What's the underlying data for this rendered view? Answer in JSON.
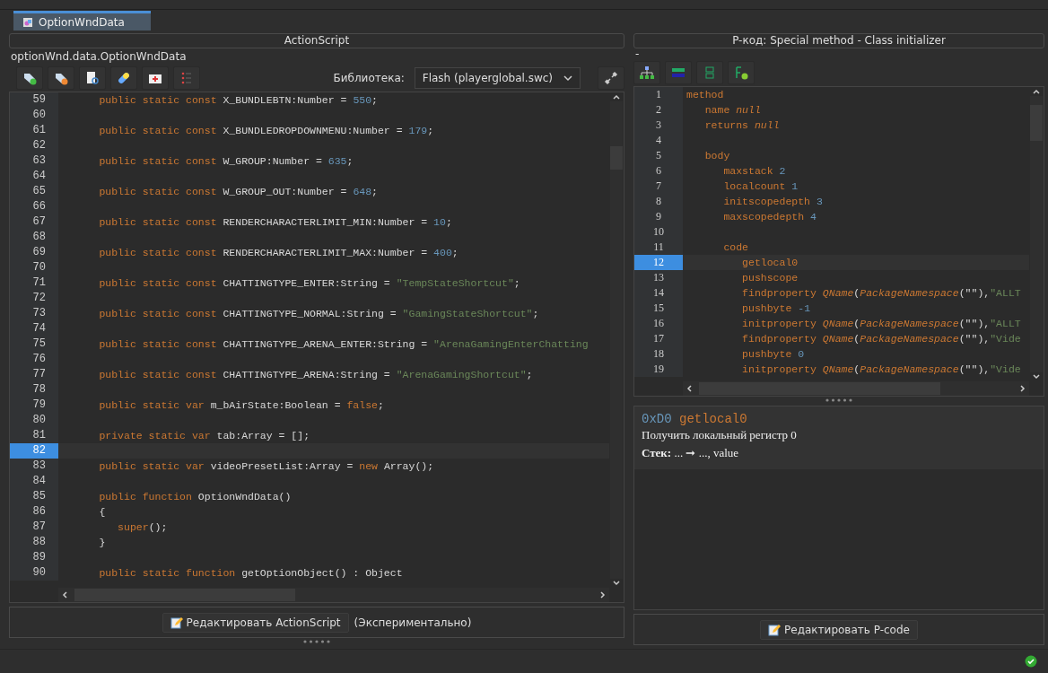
{
  "tabs": [
    {
      "label": "OptionWndData",
      "selected": true
    }
  ],
  "left_panel": {
    "title": "ActionScript",
    "path": "optionWnd.data.OptionWndData",
    "toolbar": [
      {
        "kind": "tag-plus"
      },
      {
        "kind": "tag-minus"
      },
      {
        "kind": "search-doc"
      },
      {
        "kind": "pill"
      },
      {
        "kind": "medkit"
      },
      {
        "kind": "list"
      }
    ],
    "library_label": "Библиотека:",
    "library_value": "Flash (playerglobal.swc)",
    "code_lines": [
      {
        "num": "59",
        "selected": false,
        "tokens": [
          {
            "kind": "kw",
            "text": "      public static const "
          },
          {
            "kind": "id",
            "text": "X_BUNDLEBTN:Number = "
          },
          {
            "kind": "num",
            "text": "550"
          },
          {
            "kind": "id",
            "text": ";"
          }
        ]
      },
      {
        "num": "60",
        "selected": false
      },
      {
        "num": "61",
        "selected": false,
        "tokens": [
          {
            "kind": "kw",
            "text": "      public static const "
          },
          {
            "kind": "id",
            "text": "X_BUNDLEDROPDOWNMENU:Number = "
          },
          {
            "kind": "num",
            "text": "179"
          },
          {
            "kind": "id",
            "text": ";"
          }
        ]
      },
      {
        "num": "62",
        "selected": false
      },
      {
        "num": "63",
        "selected": false,
        "tokens": [
          {
            "kind": "kw",
            "text": "      public static const "
          },
          {
            "kind": "id",
            "text": "W_GROUP:Number = "
          },
          {
            "kind": "num",
            "text": "635"
          },
          {
            "kind": "id",
            "text": ";"
          }
        ]
      },
      {
        "num": "64",
        "selected": false
      },
      {
        "num": "65",
        "selected": false,
        "tokens": [
          {
            "kind": "kw",
            "text": "      public static const "
          },
          {
            "kind": "id",
            "text": "W_GROUP_OUT:Number = "
          },
          {
            "kind": "num",
            "text": "648"
          },
          {
            "kind": "id",
            "text": ";"
          }
        ]
      },
      {
        "num": "66",
        "selected": false
      },
      {
        "num": "67",
        "selected": false,
        "tokens": [
          {
            "kind": "kw",
            "text": "      public static const "
          },
          {
            "kind": "id",
            "text": "RENDERCHARACTERLIMIT_MIN:Number = "
          },
          {
            "kind": "num",
            "text": "10"
          },
          {
            "kind": "id",
            "text": ";"
          }
        ]
      },
      {
        "num": "68",
        "selected": false
      },
      {
        "num": "69",
        "selected": false,
        "tokens": [
          {
            "kind": "kw",
            "text": "      public static const "
          },
          {
            "kind": "id",
            "text": "RENDERCHARACTERLIMIT_MAX:Number = "
          },
          {
            "kind": "num",
            "text": "400"
          },
          {
            "kind": "id",
            "text": ";"
          }
        ]
      },
      {
        "num": "70",
        "selected": false
      },
      {
        "num": "71",
        "selected": false,
        "tokens": [
          {
            "kind": "kw",
            "text": "      public static const "
          },
          {
            "kind": "id",
            "text": "CHATTINGTYPE_ENTER:String = "
          },
          {
            "kind": "str",
            "text": "\"TempStateShortcut\""
          },
          {
            "kind": "id",
            "text": ";"
          }
        ]
      },
      {
        "num": "72",
        "selected": false
      },
      {
        "num": "73",
        "selected": false,
        "tokens": [
          {
            "kind": "kw",
            "text": "      public static const "
          },
          {
            "kind": "id",
            "text": "CHATTINGTYPE_NORMAL:String = "
          },
          {
            "kind": "str",
            "text": "\"GamingStateShortcut\""
          },
          {
            "kind": "id",
            "text": ";"
          }
        ]
      },
      {
        "num": "74",
        "selected": false
      },
      {
        "num": "75",
        "selected": false,
        "tokens": [
          {
            "kind": "kw",
            "text": "      public static const "
          },
          {
            "kind": "id",
            "text": "CHATTINGTYPE_ARENA_ENTER:String = "
          },
          {
            "kind": "str",
            "text": "\"ArenaGamingEnterChatting"
          }
        ]
      },
      {
        "num": "76",
        "selected": false
      },
      {
        "num": "77",
        "selected": false,
        "tokens": [
          {
            "kind": "kw",
            "text": "      public static const "
          },
          {
            "kind": "id",
            "text": "CHATTINGTYPE_ARENA:String = "
          },
          {
            "kind": "str",
            "text": "\"ArenaGamingShortcut\""
          },
          {
            "kind": "id",
            "text": ";"
          }
        ]
      },
      {
        "num": "78",
        "selected": false
      },
      {
        "num": "79",
        "selected": false,
        "tokens": [
          {
            "kind": "kw",
            "text": "      public static var "
          },
          {
            "kind": "id",
            "text": "m_bAirState:Boolean = "
          },
          {
            "kind": "kw",
            "text": "false"
          },
          {
            "kind": "id",
            "text": ";"
          }
        ]
      },
      {
        "num": "80",
        "selected": false
      },
      {
        "num": "81",
        "selected": false,
        "tokens": [
          {
            "kind": "kw",
            "text": "      private static var "
          },
          {
            "kind": "id",
            "text": "tab:Array = [];"
          }
        ]
      },
      {
        "num": "82",
        "selected": true
      },
      {
        "num": "83",
        "selected": false,
        "tokens": [
          {
            "kind": "kw",
            "text": "      public static var "
          },
          {
            "kind": "id",
            "text": "videoPresetList:Array = "
          },
          {
            "kind": "kw",
            "text": "new "
          },
          {
            "kind": "id",
            "text": "Array();"
          }
        ]
      },
      {
        "num": "84",
        "selected": false
      },
      {
        "num": "85",
        "selected": false,
        "tokens": [
          {
            "kind": "kw",
            "text": "      public function "
          },
          {
            "kind": "id",
            "text": "OptionWndData()"
          }
        ]
      },
      {
        "num": "86",
        "selected": false,
        "tokens": [
          {
            "kind": "id",
            "text": "      {"
          }
        ]
      },
      {
        "num": "87",
        "selected": false,
        "tokens": [
          {
            "kind": "kw",
            "text": "         super"
          },
          {
            "kind": "id",
            "text": "();"
          }
        ]
      },
      {
        "num": "88",
        "selected": false,
        "tokens": [
          {
            "kind": "id",
            "text": "      }"
          }
        ]
      },
      {
        "num": "89",
        "selected": false
      },
      {
        "num": "90",
        "selected": false,
        "tokens": [
          {
            "kind": "kw",
            "text": "      public static function "
          },
          {
            "kind": "id",
            "text": "getOptionObject() : Object"
          }
        ]
      }
    ],
    "edit_button": "Редактировать ActionScript",
    "edit_note": "(Экспериментально)"
  },
  "right_panel": {
    "title": "P-код: Special method - Class initializer",
    "subtitle": "-",
    "toolbar": [
      {
        "kind": "tree"
      },
      {
        "kind": "hex-text"
      },
      {
        "kind": "hex"
      },
      {
        "kind": "add-func"
      }
    ],
    "code_lines": [
      {
        "num": "1",
        "selected": false,
        "tokens": [
          {
            "kind": "kw",
            "text": "method"
          }
        ]
      },
      {
        "num": "2",
        "selected": false,
        "tokens": [
          {
            "kind": "kw",
            "text": "   name "
          },
          {
            "kind": "it",
            "text": "null"
          }
        ]
      },
      {
        "num": "3",
        "selected": false,
        "tokens": [
          {
            "kind": "kw",
            "text": "   returns "
          },
          {
            "kind": "it",
            "text": "null"
          }
        ]
      },
      {
        "num": "4",
        "selected": false
      },
      {
        "num": "5",
        "selected": false,
        "tokens": [
          {
            "kind": "kw",
            "text": "   body"
          }
        ]
      },
      {
        "num": "6",
        "selected": false,
        "tokens": [
          {
            "kind": "kw",
            "text": "      maxstack "
          },
          {
            "kind": "num",
            "text": "2"
          }
        ]
      },
      {
        "num": "7",
        "selected": false,
        "tokens": [
          {
            "kind": "kw",
            "text": "      localcount "
          },
          {
            "kind": "num",
            "text": "1"
          }
        ]
      },
      {
        "num": "8",
        "selected": false,
        "tokens": [
          {
            "kind": "kw",
            "text": "      initscopedepth "
          },
          {
            "kind": "num",
            "text": "3"
          }
        ]
      },
      {
        "num": "9",
        "selected": false,
        "tokens": [
          {
            "kind": "kw",
            "text": "      maxscopedepth "
          },
          {
            "kind": "num",
            "text": "4"
          }
        ]
      },
      {
        "num": "10",
        "selected": false
      },
      {
        "num": "11",
        "selected": false,
        "tokens": [
          {
            "kind": "kw",
            "text": "      code"
          }
        ]
      },
      {
        "num": "12",
        "selected": true,
        "tokens": [
          {
            "kind": "kw",
            "text": "         getlocal0"
          }
        ]
      },
      {
        "num": "13",
        "selected": false,
        "tokens": [
          {
            "kind": "kw",
            "text": "         pushscope"
          }
        ]
      },
      {
        "num": "14",
        "selected": false,
        "tokens": [
          {
            "kind": "kw",
            "text": "         findproperty "
          },
          {
            "kind": "it",
            "text": "QName"
          },
          {
            "kind": "id",
            "text": "("
          },
          {
            "kind": "it",
            "text": "PackageNamespace"
          },
          {
            "kind": "id",
            "text": "(\"\"),"
          },
          {
            "kind": "str",
            "text": "\"ALLT"
          }
        ]
      },
      {
        "num": "15",
        "selected": false,
        "tokens": [
          {
            "kind": "kw",
            "text": "         pushbyte "
          },
          {
            "kind": "num",
            "text": "-1"
          }
        ]
      },
      {
        "num": "16",
        "selected": false,
        "tokens": [
          {
            "kind": "kw",
            "text": "         initproperty "
          },
          {
            "kind": "it",
            "text": "QName"
          },
          {
            "kind": "id",
            "text": "("
          },
          {
            "kind": "it",
            "text": "PackageNamespace"
          },
          {
            "kind": "id",
            "text": "(\"\"),"
          },
          {
            "kind": "str",
            "text": "\"ALLT"
          }
        ]
      },
      {
        "num": "17",
        "selected": false,
        "tokens": [
          {
            "kind": "kw",
            "text": "         findproperty "
          },
          {
            "kind": "it",
            "text": "QName"
          },
          {
            "kind": "id",
            "text": "("
          },
          {
            "kind": "it",
            "text": "PackageNamespace"
          },
          {
            "kind": "id",
            "text": "(\"\"),"
          },
          {
            "kind": "str",
            "text": "\"Vide"
          }
        ]
      },
      {
        "num": "18",
        "selected": false,
        "tokens": [
          {
            "kind": "kw",
            "text": "         pushbyte "
          },
          {
            "kind": "num",
            "text": "0"
          }
        ]
      },
      {
        "num": "19",
        "selected": false,
        "tokens": [
          {
            "kind": "kw",
            "text": "         initproperty "
          },
          {
            "kind": "it",
            "text": "QName"
          },
          {
            "kind": "id",
            "text": "("
          },
          {
            "kind": "it",
            "text": "PackageNamespace"
          },
          {
            "kind": "id",
            "text": "(\"\"),"
          },
          {
            "kind": "str",
            "text": "\"Vide"
          }
        ]
      }
    ],
    "doc": {
      "opcode": "0xD0",
      "mnemonic": "getlocal0",
      "description": "Получить локальный регистр 0",
      "stack": "**Стек:** ... ➞ ..., value"
    },
    "edit_button": "Редактировать P-code"
  }
}
